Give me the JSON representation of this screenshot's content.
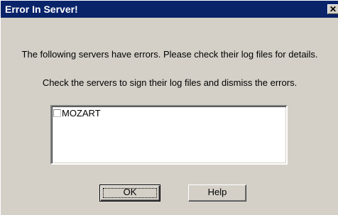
{
  "window": {
    "title": "Error In Server!",
    "close_glyph": "✕",
    "colors": {
      "titlebar": "#0a246a",
      "face": "#d4d0c8"
    }
  },
  "message": {
    "line1": "The following servers have errors. Please check their log files for details.",
    "line2": "Check the servers to sign their log files and dismiss the errors."
  },
  "servers": [
    {
      "name": "MOZART",
      "checked": false
    }
  ],
  "buttons": {
    "ok_label": "OK",
    "help_label": "Help"
  }
}
